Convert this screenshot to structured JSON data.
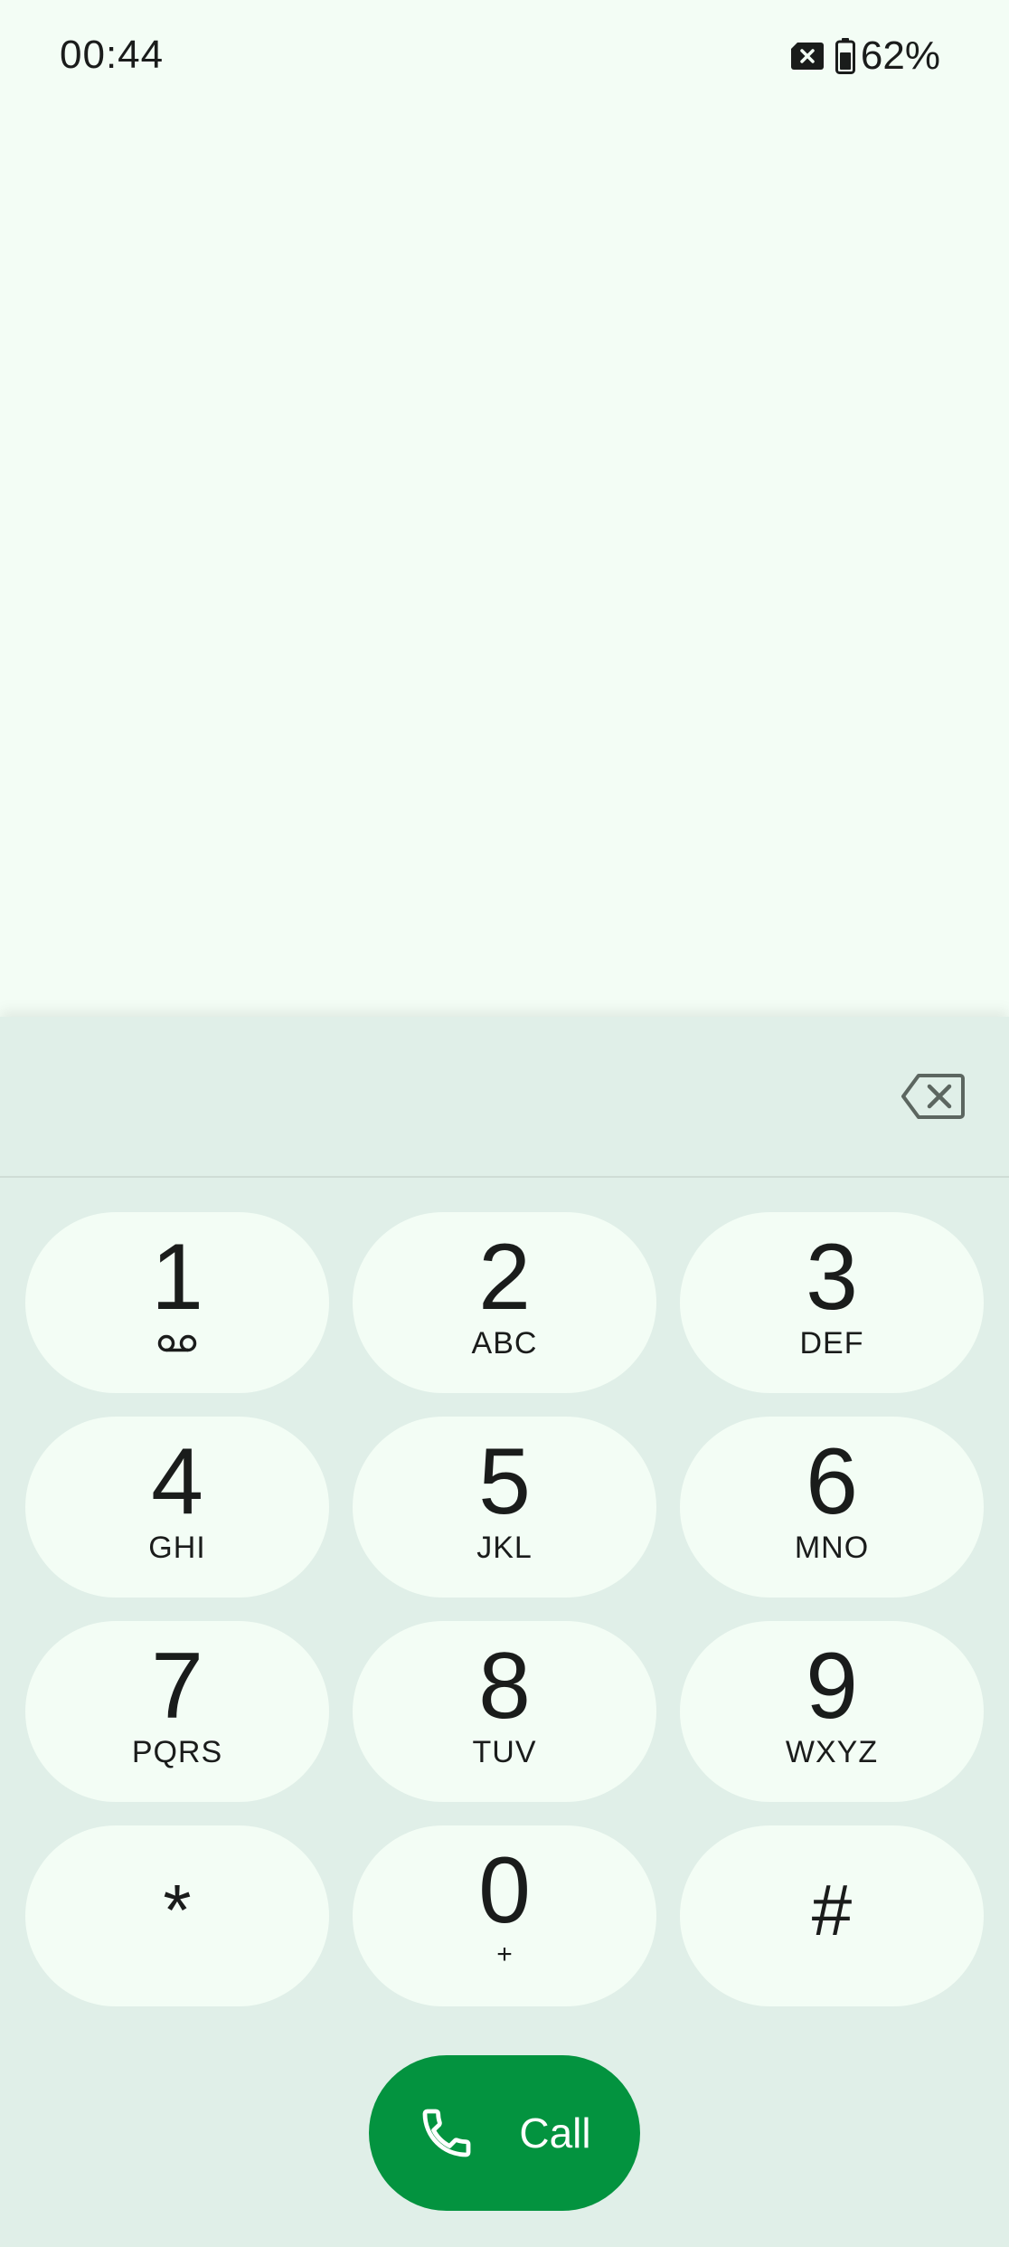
{
  "status_bar": {
    "time": "00:44",
    "battery_percent": "62%",
    "icons": [
      "no-sim-icon",
      "battery-icon"
    ]
  },
  "dialer": {
    "entered_digits": "",
    "backspace_icon": "backspace-icon"
  },
  "keypad": {
    "keys": [
      {
        "digit": "1",
        "letters": "",
        "sub_icon": "voicemail-icon"
      },
      {
        "digit": "2",
        "letters": "ABC"
      },
      {
        "digit": "3",
        "letters": "DEF"
      },
      {
        "digit": "4",
        "letters": "GHI"
      },
      {
        "digit": "5",
        "letters": "JKL"
      },
      {
        "digit": "6",
        "letters": "MNO"
      },
      {
        "digit": "7",
        "letters": "PQRS"
      },
      {
        "digit": "8",
        "letters": "TUV"
      },
      {
        "digit": "9",
        "letters": "WXYZ"
      },
      {
        "digit": "*",
        "letters": ""
      },
      {
        "digit": "0",
        "letters": "+"
      },
      {
        "digit": "#",
        "letters": ""
      }
    ]
  },
  "call_button": {
    "label": "Call",
    "icon": "phone-icon"
  },
  "colors": {
    "background": "#f3fdf5",
    "dialpad_sheet": "#e0efe8",
    "key_background": "#f3fdf5",
    "call_green": "#03933f",
    "text": "#1a1c1b"
  }
}
